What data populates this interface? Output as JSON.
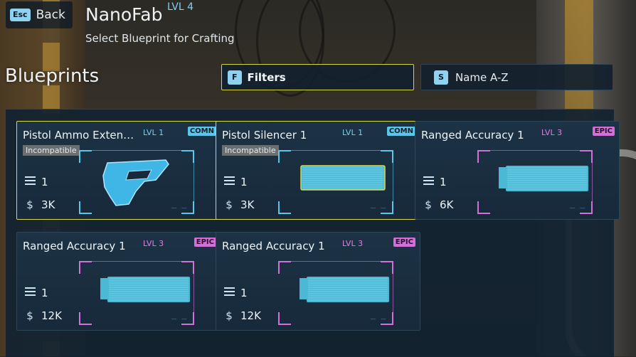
{
  "header": {
    "back_key": "Esc",
    "back_label": "Back",
    "title": "NanoFab",
    "level": "LVL 4",
    "subtitle": "Select Blueprint for Crafting"
  },
  "section_title": "Blueprints",
  "filters": {
    "key": "F",
    "label": "Filters"
  },
  "sort": {
    "key": "S",
    "label": "Name A-Z"
  },
  "colors": {
    "comn": "#5cc6ea",
    "epic": "#d36fd8",
    "selected_border": "#d8d84a",
    "panel": "#132331"
  },
  "cards": [
    {
      "name": "Pistol Ammo Exten…",
      "level": "LVL 1",
      "rarity": "COMN",
      "incompatible": "Incompatible",
      "count": "1",
      "price": "3K",
      "icon": "pistol-ammo-extender-icon"
    },
    {
      "name": "Pistol Silencer 1",
      "level": "LVL 1",
      "rarity": "COMN",
      "incompatible": "Incompatible",
      "count": "1",
      "price": "3K",
      "icon": "pistol-silencer-icon"
    },
    {
      "name": "Ranged Accuracy 1",
      "level": "LVL 3",
      "rarity": "EPIC",
      "count": "1",
      "price": "6K",
      "icon": "ranged-accuracy-mod-icon"
    },
    {
      "name": "Ranged Accuracy 1",
      "level": "LVL 3",
      "rarity": "EPIC",
      "count": "1",
      "price": "12K",
      "icon": "ranged-accuracy-mod-icon"
    },
    {
      "name": "Ranged Accuracy 1",
      "level": "LVL 3",
      "rarity": "EPIC",
      "count": "1",
      "price": "12K",
      "icon": "ranged-accuracy-mod-icon"
    }
  ]
}
